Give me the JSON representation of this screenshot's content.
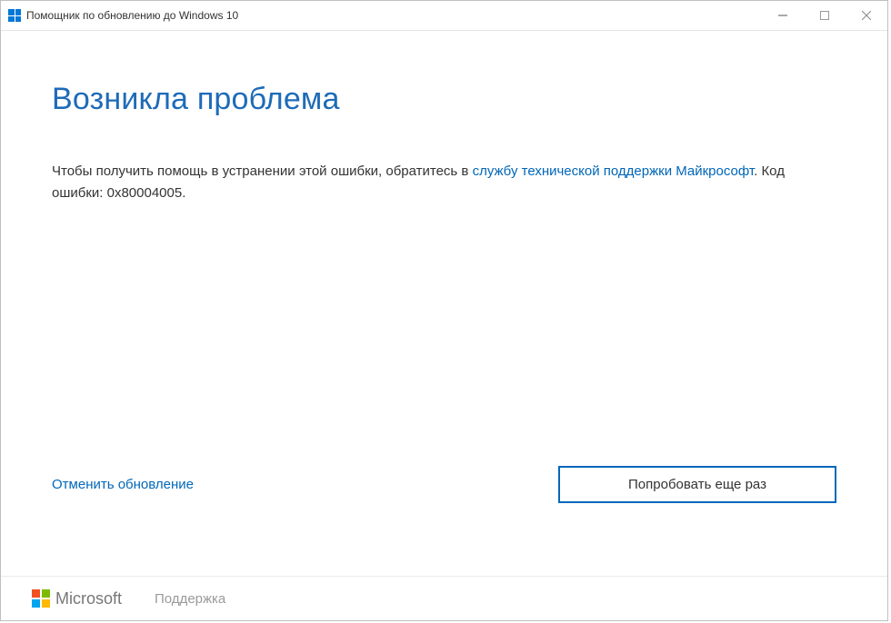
{
  "titlebar": {
    "title": "Помощник по обновлению до Windows 10"
  },
  "main": {
    "heading": "Возникла проблема",
    "body_before_link": "Чтобы получить помощь в устранении этой ошибки, обратитесь в ",
    "support_link_text": "службу технической поддержки Майкрософт",
    "body_after_link": ". Код ошибки: 0x80004005."
  },
  "actions": {
    "cancel": "Отменить обновление",
    "retry": "Попробовать еще раз"
  },
  "footer": {
    "brand": "Microsoft",
    "support": "Поддержка"
  }
}
